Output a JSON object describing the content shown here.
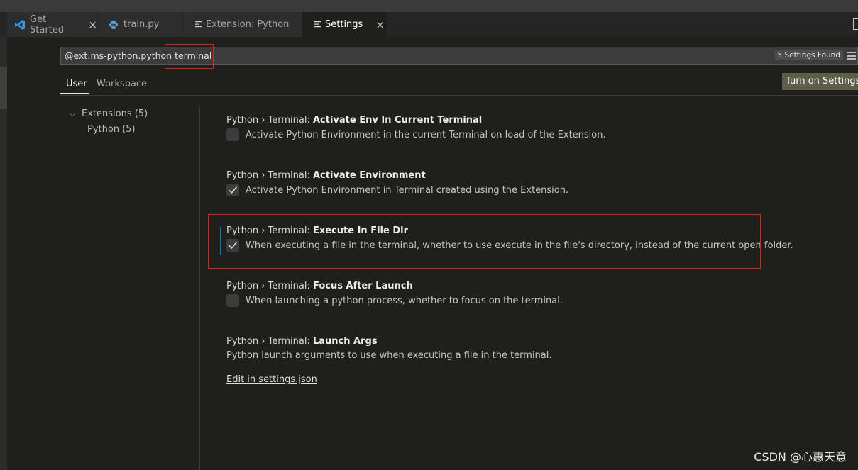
{
  "tabs": [
    {
      "label": "Get Started",
      "icon": "vscode-logo-icon",
      "close": "×"
    },
    {
      "label": "train.py",
      "icon": "python-file-icon"
    },
    {
      "label": "Extension: Python",
      "icon": "preview-icon"
    },
    {
      "label": "Settings",
      "icon": "preview-icon",
      "close": "×",
      "active": true
    }
  ],
  "search": {
    "query": "@ext:ms-python.python terminal",
    "result_count": "5 Settings Found",
    "filter_icon": "filter-lines-icon"
  },
  "scope_tabs": [
    {
      "label": "User",
      "active": true
    },
    {
      "label": "Workspace"
    }
  ],
  "sync_button": "Turn on Settings Sync",
  "toc": {
    "group": {
      "chevron": "⌵",
      "label": "Extensions (5)"
    },
    "child": "Python (5)"
  },
  "settings": [
    {
      "category": "Python › Terminal: ",
      "name": "Activate Env In Current Terminal",
      "checked": false,
      "description": "Activate Python Environment in the current Terminal on load of the Extension."
    },
    {
      "category": "Python › Terminal: ",
      "name": "Activate Environment",
      "checked": true,
      "description": "Activate Python Environment in Terminal created using the Extension."
    },
    {
      "category": "Python › Terminal: ",
      "name": "Execute In File Dir",
      "checked": true,
      "focused": true,
      "description": "When executing a file in the terminal, whether to use execute in the file's directory, instead of the current open folder."
    },
    {
      "category": "Python › Terminal: ",
      "name": "Focus After Launch",
      "checked": false,
      "description": "When launching a python process, whether to focus on the terminal."
    },
    {
      "category": "Python › Terminal: ",
      "name": "Launch Args",
      "description": "Python launch arguments to use when executing a file in the terminal.",
      "link": "Edit in settings.json"
    }
  ],
  "annotation_color": "#e02020",
  "watermark": "CSDN @心惠天意"
}
